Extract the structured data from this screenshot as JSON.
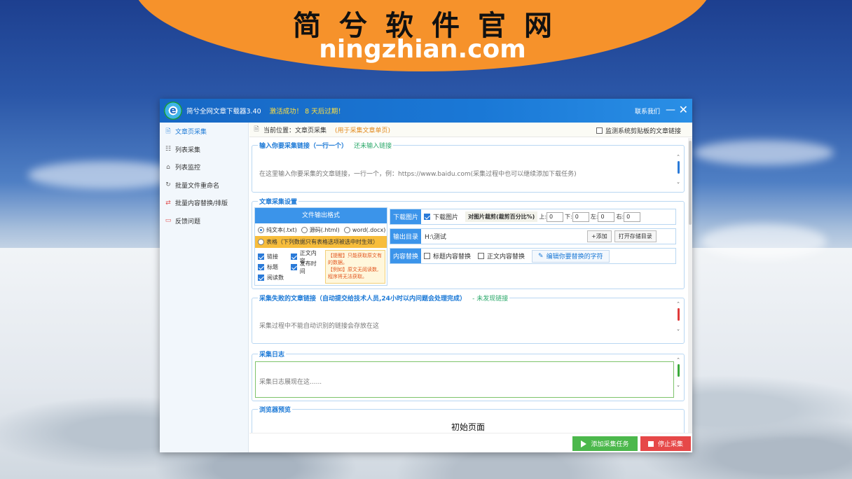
{
  "banner": {
    "title": "简兮软件官网",
    "url": "ningzhian.com"
  },
  "app": {
    "title": "简兮全网文章下载器3.40",
    "activation": "激活成功！ 8 天后过期！",
    "contact": "联系我们",
    "minimize_glyph": "—",
    "close_glyph": "✕"
  },
  "sidebar": {
    "items": [
      {
        "label": "文章页采集",
        "icon": "document-icon"
      },
      {
        "label": "列表采集",
        "icon": "list-icon"
      },
      {
        "label": "列表监控",
        "icon": "monitor-icon"
      },
      {
        "label": "批量文件重命名",
        "icon": "rename-icon"
      },
      {
        "label": "批量内容替换/排版",
        "icon": "replace-icon"
      },
      {
        "label": "反馈问题",
        "icon": "feedback-icon"
      }
    ],
    "active_index": 0
  },
  "location": {
    "prefix": "当前位置：",
    "page": "文章页采集",
    "note": "(用于采集文章单页)",
    "monitor_label": "监测系统剪贴板的文章链接",
    "monitor_checked": false
  },
  "links_group": {
    "legend": "输入你要采集链接（一行一个）",
    "status": "还未输入链接",
    "placeholder": "在这里输入你要采集的文章链接，一行一个，例：https://www.baidu.com(采集过程中也可以继续添加下载任务)"
  },
  "settings_group": {
    "legend": "文章采集设置",
    "format_header": "文件输出格式",
    "formats": [
      {
        "label": "纯文本(.txt)",
        "selected": true
      },
      {
        "label": "源码(.html)",
        "selected": false
      },
      {
        "label": "word(.docx)",
        "selected": false
      }
    ],
    "table_option": "表格（下列数据只有表格选项被选中时生效）",
    "fields": [
      {
        "label": "链接",
        "checked": true
      },
      {
        "label": "正文内容",
        "checked": true
      },
      {
        "label": "标题",
        "checked": true
      },
      {
        "label": "发布时间",
        "checked": true
      },
      {
        "label": "阅读数",
        "checked": true
      }
    ],
    "note_lines": [
      "【提醒】只能获取原文有的数据。",
      "【例如】原文无阅读数,程序将无法获取。"
    ],
    "download_images": {
      "label": "下载图片",
      "checkbox_label": "下载图片",
      "checked": true,
      "crop_label": "对图片裁剪(裁剪百分比%)",
      "crop": [
        {
          "side": "上:",
          "value": "0"
        },
        {
          "side": "下:",
          "value": "0"
        },
        {
          "side": "左:",
          "value": "0"
        },
        {
          "side": "右:",
          "value": "0"
        }
      ]
    },
    "output": {
      "label": "输出目录",
      "path": "H:\\测试",
      "add_button": "+添加",
      "open_button": "打开存储目录"
    },
    "replace": {
      "label": "内容替换",
      "title_replace": "标题内容替换",
      "body_replace": "正文内容替换",
      "edit_button": "编辑你要替换的字符"
    }
  },
  "failed_group": {
    "legend": "采集失败的文章链接（自动提交给技术人员,24小时以内问题会处理完成）",
    "status": "- 未发现链接",
    "placeholder": "采集过程中不能自动识别的链接会存放在这"
  },
  "log_group": {
    "legend": "采集日志",
    "placeholder": "采集日志展现在这......"
  },
  "preview_group": {
    "legend": "浏览器预览",
    "content": "初始页面"
  },
  "actions": {
    "add_task": "添加采集任务",
    "stop": "停止采集"
  },
  "colors": {
    "banner_orange": "#f6922b",
    "titlebar_blue": "#1a78d6",
    "accent_blue": "#3b94ea",
    "add_green": "#4cb84c",
    "stop_red": "#e64848"
  }
}
